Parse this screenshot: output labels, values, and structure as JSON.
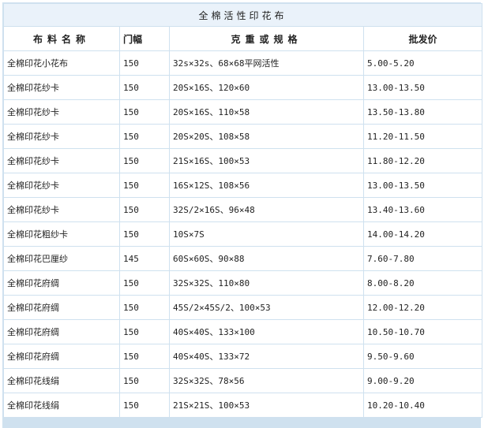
{
  "title": "全棉活性印花布",
  "headers": [
    "布料名称",
    "门幅",
    "克重或规格",
    "批发价"
  ],
  "rows": [
    {
      "name": "全棉印花小花布",
      "width": "150",
      "spec": "32s×32s、68×68平网活性",
      "price": "5.00-5.20"
    },
    {
      "name": "全棉印花纱卡",
      "width": "150",
      "spec": "20S×16S、120×60",
      "price": "13.00-13.50"
    },
    {
      "name": "全棉印花纱卡",
      "width": "150",
      "spec": "20S×16S、110×58",
      "price": "13.50-13.80"
    },
    {
      "name": "全棉印花纱卡",
      "width": "150",
      "spec": "20S×20S、108×58",
      "price": "11.20-11.50"
    },
    {
      "name": "全棉印花纱卡",
      "width": "150",
      "spec": "21S×16S、100×53",
      "price": "11.80-12.20"
    },
    {
      "name": "全棉印花纱卡",
      "width": "150",
      "spec": "16S×12S、108×56",
      "price": "13.00-13.50"
    },
    {
      "name": "全棉印花纱卡",
      "width": "150",
      "spec": "32S/2×16S、96×48",
      "price": "13.40-13.60"
    },
    {
      "name": "全棉印花粗纱卡",
      "width": "150",
      "spec": "10S×7S",
      "price": "14.00-14.20"
    },
    {
      "name": "全棉印花巴厘纱",
      "width": "145",
      "spec": "60S×60S、90×88",
      "price": "7.60-7.80"
    },
    {
      "name": "全棉印花府绸",
      "width": "150",
      "spec": "32S×32S、110×80",
      "price": "8.00-8.20"
    },
    {
      "name": "全棉印花府绸",
      "width": "150",
      "spec": "45S/2×45S/2、100×53",
      "price": "12.00-12.20"
    },
    {
      "name": "全棉印花府绸",
      "width": "150",
      "spec": "40S×40S、133×100",
      "price": "10.50-10.70"
    },
    {
      "name": "全棉印花府绸",
      "width": "150",
      "spec": "40S×40S、133×72",
      "price": "9.50-9.60"
    },
    {
      "name": "全棉印花线绢",
      "width": "150",
      "spec": "32S×32S、78×56",
      "price": "9.00-9.20"
    },
    {
      "name": "全棉印花线绢",
      "width": "150",
      "spec": "21S×21S、100×53",
      "price": "10.20-10.40"
    }
  ],
  "colors": {
    "border": "#cfe1ef",
    "title_bg": "#eaf2fa",
    "text": "#222222"
  }
}
